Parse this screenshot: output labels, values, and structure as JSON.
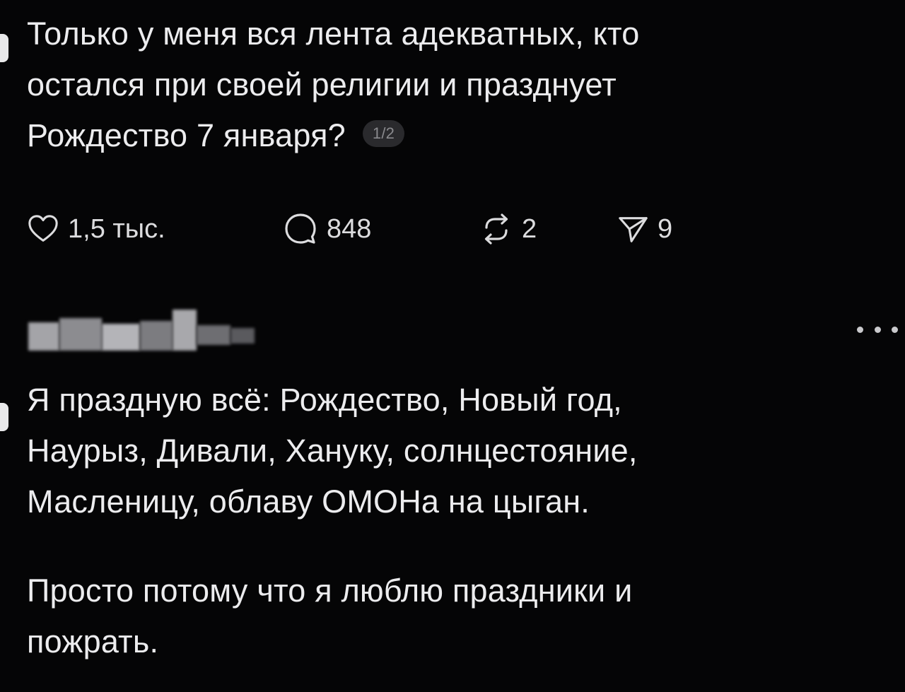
{
  "post1": {
    "lines": [
      "Только у меня вся лента адекватных, кто",
      "остался при своей религии и празднует",
      "Рождество 7 января?"
    ],
    "page_indicator": "1/2",
    "actions": {
      "likes": "1,5 тыс.",
      "comments": "848",
      "reposts": "2",
      "shares": "9"
    }
  },
  "post2": {
    "author_name_blurred": true,
    "paragraph1": [
      "Я праздную всё: Рождество, Новый год,",
      "Наурыз, Дивали, Хануку, солнцестояние,",
      "Масленицу, облаву ОМОНа на цыган."
    ],
    "paragraph2": [
      "Просто потому что я люблю праздники и",
      "пожрать."
    ]
  },
  "icons": {
    "like": "heart-icon",
    "comment": "comment-bubble-icon",
    "repost": "repost-arrows-icon",
    "share": "paper-plane-icon",
    "more": "more-dots-icon"
  },
  "colors": {
    "background": "#050506",
    "text": "#ececee",
    "muted": "#8a8a8e"
  }
}
